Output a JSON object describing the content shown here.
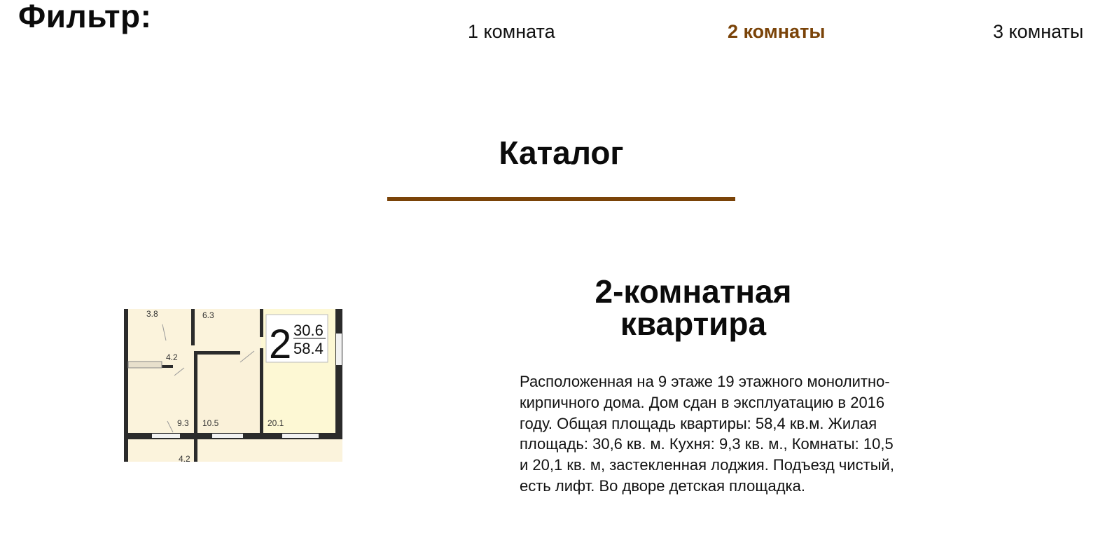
{
  "filter": {
    "title": "Фильтр:",
    "options": [
      {
        "label": "1 комната",
        "active": false
      },
      {
        "label": "2 комнаты",
        "active": true
      },
      {
        "label": "3 комнаты",
        "active": false
      }
    ]
  },
  "catalog": {
    "title": "Каталог"
  },
  "colors": {
    "accent": "#7a4308",
    "text": "#111111",
    "plan_wall": "#2b2b2b",
    "plan_floor": "#fbf3dc"
  },
  "listing": {
    "title_line1": "2-комнатная",
    "title_line2": "квартира",
    "description": "Расположенная на 9 этаже 19 этажного монолитно-кирпичного дома. Дом сдан в эксплуатацию в 2016 году. Общая площадь квартиры: 58,4 кв.м. Жилая площадь: 30,6 кв. м. Кухня: 9,3 кв. м., Комнаты: 10,5 и 20,1 кв. м, застекленная лоджия. Подъезд чистый, есть лифт. Во дворе детская площадка.",
    "plan": {
      "rooms_count": "2",
      "living_area": "30.6",
      "total_area": "58.4",
      "labels": [
        "3.8",
        "6.3",
        "4.2",
        "9.3",
        "10.5",
        "20.1",
        "4.2"
      ]
    }
  }
}
